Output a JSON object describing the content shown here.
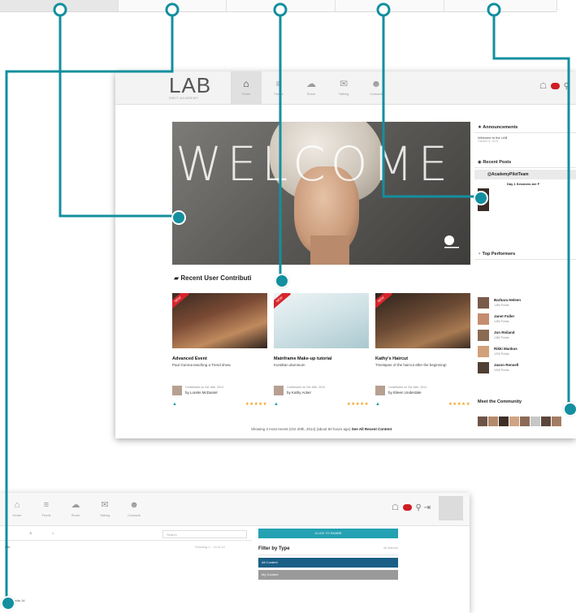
{
  "top_strip": {
    "active_cell": 0
  },
  "screen1": {
    "logo": {
      "text": "LAB",
      "subtitle": "SWIT ACADEMY"
    },
    "nav": [
      {
        "icon": "home-icon",
        "glyph": "⌂",
        "label": "Home",
        "active": true
      },
      {
        "icon": "news-icon",
        "glyph": "≡",
        "label": "Feeds",
        "active": false
      },
      {
        "icon": "cloud-icon",
        "glyph": "☁",
        "label": "Share",
        "active": false
      },
      {
        "icon": "chat-icon",
        "glyph": "✉",
        "label": "Talking",
        "active": false
      },
      {
        "icon": "people-icon",
        "glyph": "☻",
        "label": "Contacts",
        "active": false
      }
    ],
    "hero": {
      "word": "WELCOME"
    },
    "contrib_title": "Recent User Contributi",
    "cards": [
      {
        "ribbon": "NEW",
        "title": "Advanced Event",
        "desc": "Paul Gumna teaching a Trend show.",
        "meta1": "Contributed on Oct 16th, 2014",
        "author": "by Lorelei McDaniel",
        "stars": "★★★★★"
      },
      {
        "ribbon": "NEW",
        "title": "Mainframe Make-up tutorial",
        "desc": "Kuralkan aluminum",
        "meta1": "Contributed on Oct 16th, 2014",
        "author": "by Kathy Acker",
        "stars": "★★★★★"
      },
      {
        "ribbon": "NEW",
        "title": "Kathy's Haircut",
        "desc": "Timelapse of the haircut after the beginning!",
        "meta1": "Contributed on Oct 16th, 2014",
        "author": "by Eileen Underdale",
        "stars": "★★★★★"
      }
    ],
    "showing": "Showing 3 most recent (Oct 20th, 2014) (about 50 hours ago)",
    "showing_link": "See All Recent Content",
    "sidebar": {
      "announcements_title": "Announcements",
      "announcement": "Welcome to the LAB",
      "announcement_date": "October 6, 2014",
      "recent_posts_title": "Recent Posts",
      "post_handle": "@AcademyPilotTeam",
      "post_title": "Day 1 Sessions are F",
      "top_performers_title": "Top Performers",
      "performers": [
        {
          "name": "Barbara Heleen",
          "points": "1450 Points",
          "color": "#7a5a48"
        },
        {
          "name": "Janet Fuller",
          "points": "1450 Points",
          "color": "#c48d6f"
        },
        {
          "name": "Jon Reiland",
          "points": "1382 Points",
          "color": "#8b6a54"
        },
        {
          "name": "Rikki Mankus",
          "points": "1220 Points",
          "color": "#d2a17b"
        },
        {
          "name": "Jason Rensell",
          "points": "1000 Points",
          "color": "#4f3f35"
        }
      ],
      "community_title": "Meet the Community"
    }
  },
  "screen2": {
    "nav": [
      {
        "icon": "home-icon",
        "glyph": "⌂",
        "label": "Home"
      },
      {
        "icon": "news-icon",
        "glyph": "≡",
        "label": "Feeds"
      },
      {
        "icon": "cloud-icon",
        "glyph": "☁",
        "label": "Share"
      },
      {
        "icon": "chat-icon",
        "glyph": "✉",
        "label": "Talking"
      },
      {
        "icon": "people-icon",
        "glyph": "☻",
        "label": "Contacts"
      }
    ],
    "search_placeholder": "Search",
    "teal_button": "CLICK TO SHARE",
    "filter_title": "Filter by Type",
    "filter_right": "All selected",
    "options": [
      {
        "label": "All Content",
        "color": "#1b5f86"
      },
      {
        "label": "My Content",
        "color": "#9a9a9a"
      }
    ],
    "left_text1": "File",
    "left_text2": "Showing 1 - 14 of 14",
    "left_text3": "Media 14"
  },
  "colors": {
    "accent": "#138f9f",
    "brand_red": "#d11c23",
    "stars": "#f0a21c"
  }
}
